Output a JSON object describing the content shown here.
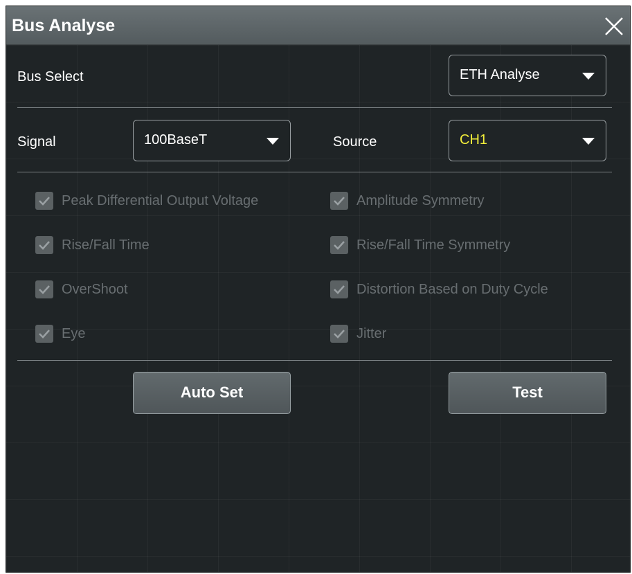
{
  "dialog": {
    "title": "Bus Analyse",
    "close_icon": "close-icon"
  },
  "bus_select": {
    "label": "Bus Select",
    "value": "ETH Analyse"
  },
  "signal": {
    "label": "Signal",
    "value": "100BaseT"
  },
  "source": {
    "label": "Source",
    "value": "CH1",
    "value_color": "#f2ee3a"
  },
  "tests": [
    {
      "label": "Peak Differential Output Voltage",
      "checked": true
    },
    {
      "label": "Amplitude Symmetry",
      "checked": true
    },
    {
      "label": "Rise/Fall Time",
      "checked": true
    },
    {
      "label": "Rise/Fall Time Symmetry",
      "checked": true
    },
    {
      "label": "OverShoot",
      "checked": true
    },
    {
      "label": "Distortion Based on Duty Cycle",
      "checked": true
    },
    {
      "label": "Eye",
      "checked": true
    },
    {
      "label": "Jitter",
      "checked": true
    }
  ],
  "buttons": {
    "auto_set": "Auto Set",
    "test": "Test"
  }
}
